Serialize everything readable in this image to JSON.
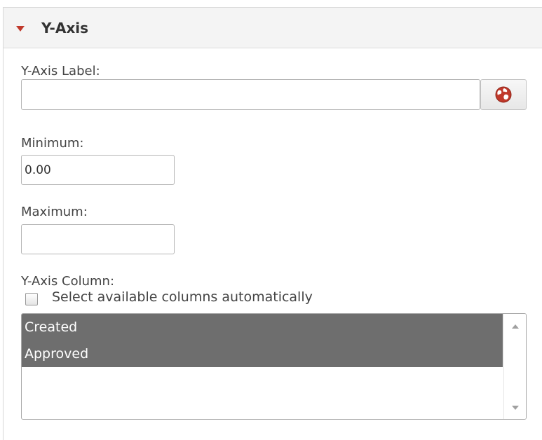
{
  "section": {
    "title": "Y-Axis",
    "expanded": true
  },
  "y_axis_label": {
    "label": "Y-Axis Label:",
    "value": "",
    "globe_icon": "globe-icon"
  },
  "minimum": {
    "label": "Minimum:",
    "value": "0.00"
  },
  "maximum": {
    "label": "Maximum:",
    "value": ""
  },
  "y_axis_column": {
    "label": "Y-Axis Column:",
    "auto_select_label": "Select available columns automatically",
    "auto_select_checked": false,
    "options": [
      {
        "label": "Created",
        "selected": true
      },
      {
        "label": "Approved",
        "selected": true
      }
    ]
  },
  "colors": {
    "caret": "#c0392b",
    "selected_row": "#6e6e6e",
    "globe": "#c0392b"
  }
}
